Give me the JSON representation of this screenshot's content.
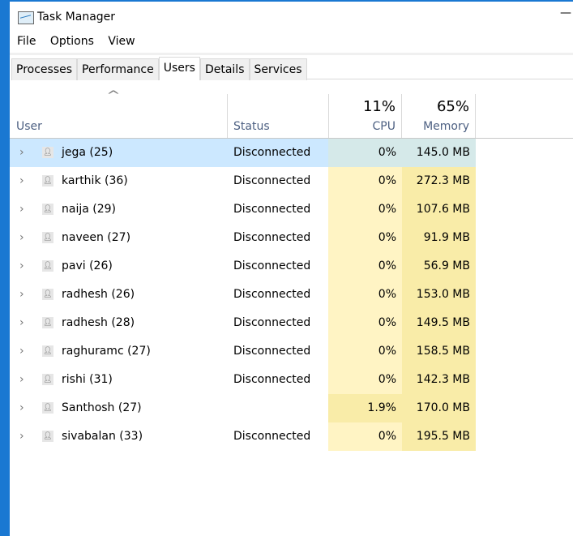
{
  "window": {
    "title": "Task Manager",
    "minimize": "—"
  },
  "menu": [
    "File",
    "Options",
    "View"
  ],
  "tabs": [
    {
      "label": "Processes"
    },
    {
      "label": "Performance"
    },
    {
      "label": "Users",
      "active": true
    },
    {
      "label": "Details"
    },
    {
      "label": "Services"
    }
  ],
  "header": {
    "sort_icon": "^",
    "user": "User",
    "status": "Status",
    "cpu_total": "11%",
    "cpu": "CPU",
    "memory_total": "65%",
    "memory": "Memory"
  },
  "rows": [
    {
      "user": "jega (25)",
      "status": "Disconnected",
      "cpu": "0%",
      "memory": "145.0 MB",
      "selected": true
    },
    {
      "user": "karthik (36)",
      "status": "Disconnected",
      "cpu": "0%",
      "memory": "272.3 MB"
    },
    {
      "user": "naija (29)",
      "status": "Disconnected",
      "cpu": "0%",
      "memory": "107.6 MB"
    },
    {
      "user": "naveen (27)",
      "status": "Disconnected",
      "cpu": "0%",
      "memory": "91.9 MB"
    },
    {
      "user": "pavi (26)",
      "status": "Disconnected",
      "cpu": "0%",
      "memory": "56.9 MB"
    },
    {
      "user": "radhesh (26)",
      "status": "Disconnected",
      "cpu": "0%",
      "memory": "153.0 MB"
    },
    {
      "user": "radhesh (28)",
      "status": "Disconnected",
      "cpu": "0%",
      "memory": "149.5 MB"
    },
    {
      "user": "raghuramc (27)",
      "status": "Disconnected",
      "cpu": "0%",
      "memory": "158.5 MB"
    },
    {
      "user": "rishi (31)",
      "status": "Disconnected",
      "cpu": "0%",
      "memory": "142.3 MB"
    },
    {
      "user": "Santhosh (27)",
      "status": "",
      "cpu": "1.9%",
      "memory": "170.0 MB",
      "cpu_high": true
    },
    {
      "user": "sivabalan (33)",
      "status": "Disconnected",
      "cpu": "0%",
      "memory": "195.5 MB"
    }
  ]
}
